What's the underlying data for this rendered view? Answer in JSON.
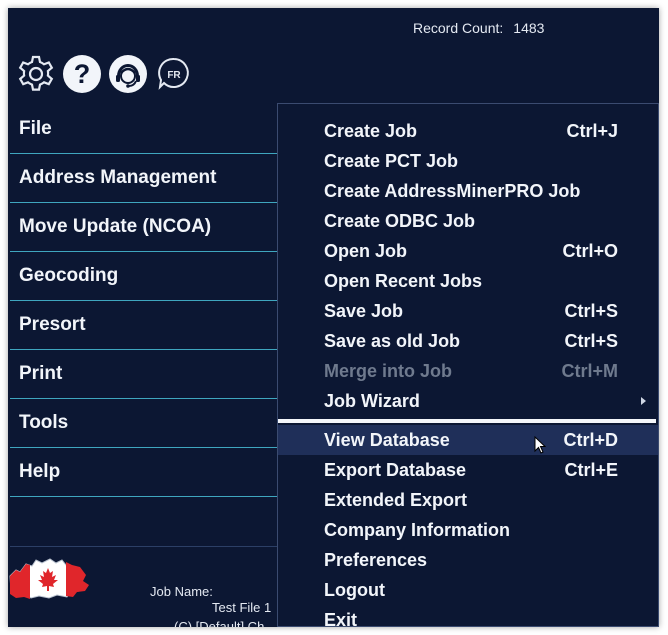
{
  "header": {
    "record_count_label": "Record Count:",
    "record_count_value": "1483"
  },
  "toolbar_icons": [
    {
      "name": "gear-icon"
    },
    {
      "name": "help-icon"
    },
    {
      "name": "support-agent-icon"
    },
    {
      "name": "french-language-icon",
      "text": "FR"
    }
  ],
  "sidebar": {
    "items": [
      {
        "label": "File"
      },
      {
        "label": "Address Management"
      },
      {
        "label": "Move Update (NCOA)"
      },
      {
        "label": "Geocoding"
      },
      {
        "label": "Presort"
      },
      {
        "label": "Print"
      },
      {
        "label": "Tools"
      },
      {
        "label": "Help"
      }
    ]
  },
  "job_info": {
    "job_name_label": "Job Name:",
    "job_file": "Test File 1",
    "job_path": "(C) [Default] Ch"
  },
  "file_menu": {
    "group1": [
      {
        "label": "Create Job",
        "shortcut": "Ctrl+J"
      },
      {
        "label": "Create PCT Job",
        "shortcut": ""
      },
      {
        "label": "Create AddressMinerPRO Job",
        "shortcut": ""
      },
      {
        "label": "Create ODBC Job",
        "shortcut": ""
      },
      {
        "label": "Open Job",
        "shortcut": "Ctrl+O"
      },
      {
        "label": "Open Recent Jobs",
        "shortcut": ""
      },
      {
        "label": "Save Job",
        "shortcut": "Ctrl+S"
      },
      {
        "label": "Save as old Job",
        "shortcut": "Ctrl+S"
      },
      {
        "label": "Merge into Job",
        "shortcut": "Ctrl+M"
      },
      {
        "label": "Job Wizard",
        "shortcut": ""
      }
    ],
    "group2": [
      {
        "label": "View Database",
        "shortcut": "Ctrl+D"
      },
      {
        "label": "Export Database",
        "shortcut": "Ctrl+E"
      },
      {
        "label": "Extended Export",
        "shortcut": ""
      },
      {
        "label": "Company Information",
        "shortcut": ""
      },
      {
        "label": "Preferences",
        "shortcut": ""
      },
      {
        "label": "Logout",
        "shortcut": ""
      },
      {
        "label": "Exit",
        "shortcut": ""
      }
    ]
  },
  "colors": {
    "background": "#0c1733",
    "divider": "#3fa6bf",
    "highlight": "#1f2f59",
    "disabled_text": "#6f7a8e",
    "text": "#f2f5fa"
  }
}
